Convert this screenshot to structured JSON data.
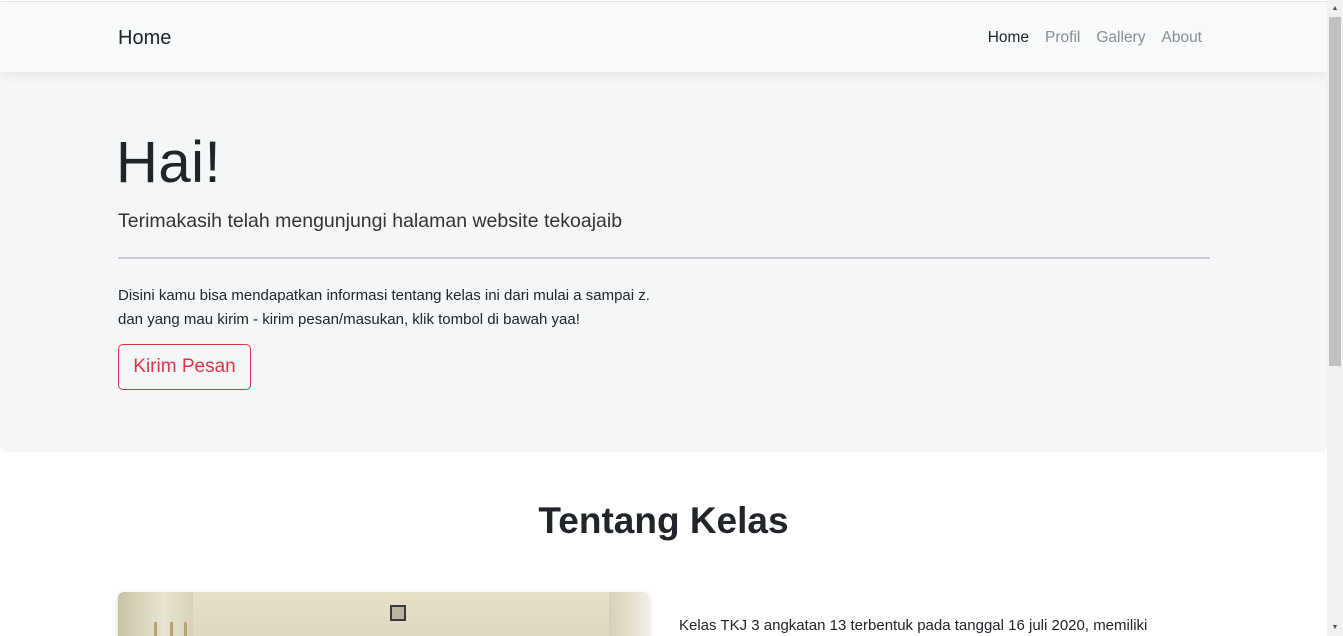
{
  "navbar": {
    "brand": "Home",
    "links": [
      "Home",
      "Profil",
      "Gallery",
      "About"
    ]
  },
  "hero": {
    "title": "Hai!",
    "lead": "Terimakasih telah mengunjungi halaman website tekoajaib",
    "text_line1": "Disini kamu bisa mendapatkan informasi tentang kelas ini dari mulai a sampai z.",
    "text_line2": "dan yang mau kirim - kirim pesan/masukan, klik tombol di bawah yaa!",
    "button": "Kirim Pesan"
  },
  "about": {
    "title": "Tentang Kelas",
    "text": "Kelas TKJ 3 angkatan 13 terbentuk pada tanggal 16 juli 2020, memiliki"
  },
  "colors": {
    "accent": "#dc3545",
    "navbar_bg": "#f8f9fa",
    "jumbotron_bg": "#f5f6f8"
  },
  "icons": {
    "scroll_up": "scroll-up-arrow-icon",
    "scroll_down": "scroll-down-arrow-icon"
  }
}
